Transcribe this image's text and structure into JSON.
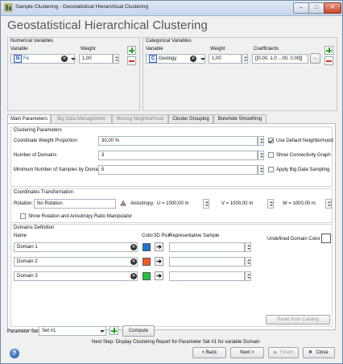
{
  "window": {
    "title": "Sample Clustering - Geostatistical Hierarchical Clustering",
    "heading": "Geostatistical Hierarchical Clustering"
  },
  "numerical": {
    "group_title": "Numerical Variables",
    "col_variable": "Variable",
    "col_weight": "Weight",
    "row": {
      "variable": "Fe",
      "weight": "1,00"
    }
  },
  "categorical": {
    "group_title": "Categorical Variables",
    "col_variable": "Variable",
    "col_weight": "Weight",
    "col_coefficients": "Coefficients",
    "row": {
      "variable": "Geology",
      "weight": "1,00",
      "coefficients": "[[0.00, 1.0 ...00, 0.00]]",
      "more": "..."
    }
  },
  "tabs": [
    {
      "label": "Main Parameters",
      "active": true,
      "enabled": true
    },
    {
      "label": "Big Data Management",
      "active": false,
      "enabled": false
    },
    {
      "label": "Moving Neighborhood",
      "active": false,
      "enabled": false
    },
    {
      "label": "Cluster Grouping",
      "active": false,
      "enabled": true
    },
    {
      "label": "Borehole Smoothing",
      "active": false,
      "enabled": true
    }
  ],
  "clustering": {
    "title": "Clustering Parameters",
    "coord_weight_label": "Coordinate Weight Proportion",
    "coord_weight_value": "30,00 %",
    "num_domains_label": "Number of Domains",
    "num_domains_value": "3",
    "min_samples_label": "Minimum Number of Samples by Domain",
    "min_samples_value": "5",
    "use_default_neighborhood": "Use Default Neighborhood",
    "show_connectivity_graph": "Show Connectivity Graph",
    "apply_big_data_sampling": "Apply Big Data Sampling"
  },
  "coords": {
    "title": "Coordinates Transformation",
    "rotation_label": "Rotation:",
    "rotation_value": "No Rotation",
    "anisotropy_label": "Anisotropy:",
    "u_value": "U = 1000,00 m",
    "v_value": "V = 1000,00 m",
    "w_value": "W = 1000,00 m",
    "show_manipulator": "Show Rotation and Anisotropy Ratio Manipulator"
  },
  "domains": {
    "title": "Domains Definition",
    "col_name": "Name",
    "col_color": "Color",
    "col_3dpick": "3D Pick",
    "col_rep_sample": "Representative Sample",
    "undefined_color_label": "Undefined Domain Color",
    "reset_button": "Reset from Catalog",
    "rows": [
      {
        "name": "Domain 1",
        "color": "#1e73d2"
      },
      {
        "name": "Domain 2",
        "color": "#f05a28"
      },
      {
        "name": "Domain 3",
        "color": "#22c43a"
      }
    ]
  },
  "footer": {
    "param_set_label": "Parameter Set",
    "param_set_value": "Set #1",
    "compute_button": "Compute",
    "next_step": "Next Step: Display Clustering Report for Parameter Set #1 for variable Domain",
    "back_button": "< Back",
    "next_button": "Next >",
    "finish_button": "Finish",
    "close_button": "Close"
  }
}
